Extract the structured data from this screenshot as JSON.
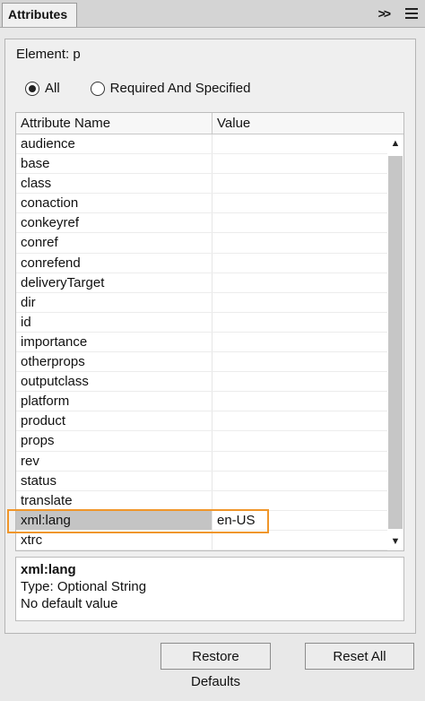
{
  "panel": {
    "tab_title": "Attributes"
  },
  "element_label": "Element: p",
  "filter": {
    "options": [
      {
        "label": "All",
        "selected": true
      },
      {
        "label": "Required And Specified",
        "selected": false
      }
    ]
  },
  "table": {
    "columns": [
      "Attribute Name",
      "Value"
    ],
    "rows": [
      {
        "name": "audience",
        "value": ""
      },
      {
        "name": "base",
        "value": ""
      },
      {
        "name": "class",
        "value": ""
      },
      {
        "name": "conaction",
        "value": ""
      },
      {
        "name": "conkeyref",
        "value": ""
      },
      {
        "name": "conref",
        "value": ""
      },
      {
        "name": "conrefend",
        "value": ""
      },
      {
        "name": "deliveryTarget",
        "value": ""
      },
      {
        "name": "dir",
        "value": ""
      },
      {
        "name": "id",
        "value": ""
      },
      {
        "name": "importance",
        "value": ""
      },
      {
        "name": "otherprops",
        "value": ""
      },
      {
        "name": "outputclass",
        "value": ""
      },
      {
        "name": "platform",
        "value": ""
      },
      {
        "name": "product",
        "value": ""
      },
      {
        "name": "props",
        "value": ""
      },
      {
        "name": "rev",
        "value": ""
      },
      {
        "name": "status",
        "value": ""
      },
      {
        "name": "translate",
        "value": ""
      },
      {
        "name": "xml:lang",
        "value": "en-US",
        "selected": true
      },
      {
        "name": "xtrc",
        "value": ""
      }
    ]
  },
  "info": {
    "title": "xml:lang",
    "type": "Type: Optional String",
    "default": "No default value"
  },
  "buttons": {
    "restore": "Restore Defaults",
    "reset": "Reset All"
  },
  "icons": {
    "overflow": "double-chevron-right-icon",
    "menu": "hamburger-menu-icon"
  },
  "colors": {
    "highlight": "#f0962a",
    "selected_row": "#c4c4c4"
  }
}
